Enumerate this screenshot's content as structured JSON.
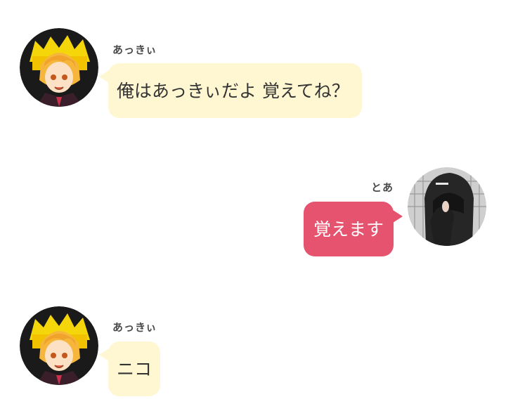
{
  "messages": [
    {
      "sender": "あっきぃ",
      "text": "俺はあっきぃだよ 覚えてね？"
    },
    {
      "sender": "とあ",
      "text": "覚えます"
    },
    {
      "sender": "あっきぃ",
      "text": "ニコ"
    }
  ],
  "colors": {
    "incoming_bubble": "#fff7d1",
    "outgoing_bubble": "#e6536f",
    "background": "#ffffff"
  }
}
